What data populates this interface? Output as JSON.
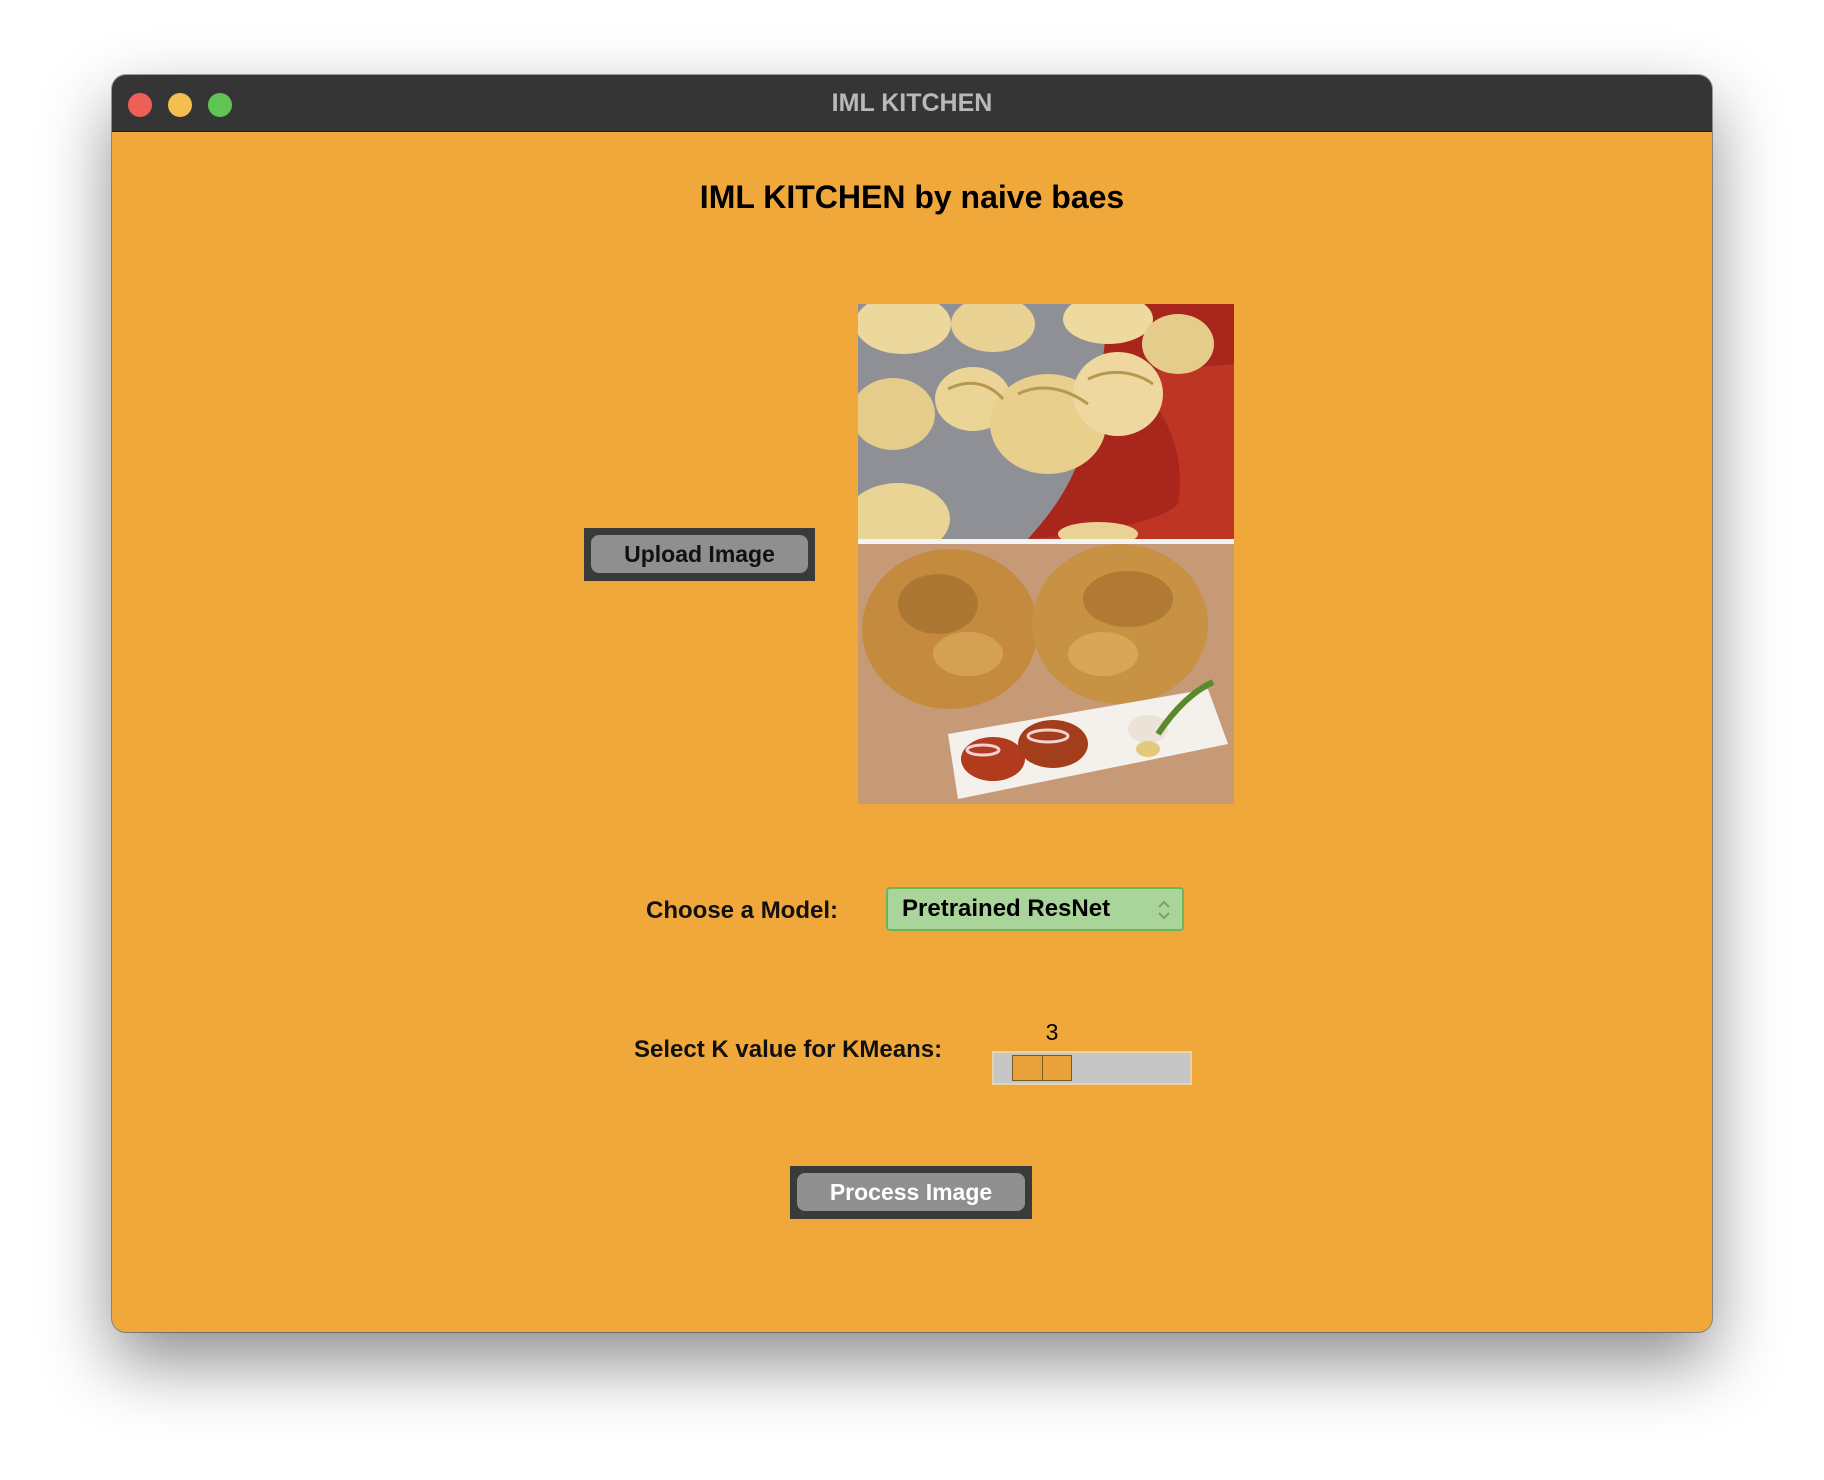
{
  "window": {
    "title": "IML KITCHEN",
    "background_color": "#f1a83b"
  },
  "main": {
    "heading": "IML KITCHEN by naive baes",
    "upload_button_label": "Upload Image",
    "model_label": "Choose a Model:",
    "model_selected": "Pretrained ResNet",
    "k_label": "Select K value for KMeans:",
    "k_value": "3",
    "process_button_label": "Process Image"
  },
  "colors": {
    "titlebar": "#353535",
    "dropdown": "#a9d59a",
    "button_face": "#8f8f8f",
    "slider_thumb": "#e9a23c"
  },
  "icons": [
    "close-icon",
    "minimize-icon",
    "maximize-icon",
    "chevron-updown-icon"
  ]
}
